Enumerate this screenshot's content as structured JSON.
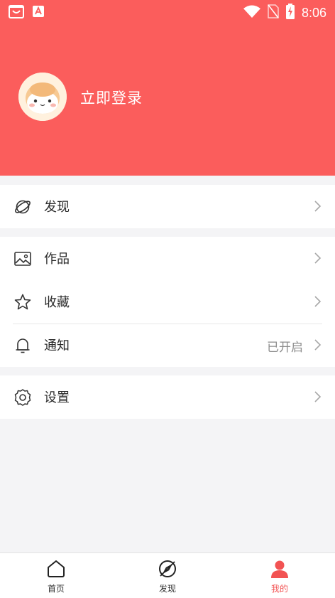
{
  "status_bar": {
    "time": "8:06",
    "icons": [
      "shopping-app-icon",
      "a-app-icon",
      "wifi-icon",
      "no-sim-icon",
      "battery-charging-icon"
    ]
  },
  "header": {
    "login_label": "立即登录",
    "background_color": "#fb5d5c"
  },
  "menu": {
    "discover": {
      "label": "发现",
      "icon": "planet-icon"
    },
    "works": {
      "label": "作品",
      "icon": "image-icon"
    },
    "favorites": {
      "label": "收藏",
      "icon": "star-icon"
    },
    "notifications": {
      "label": "通知",
      "icon": "bell-icon",
      "status": "已开启"
    },
    "settings": {
      "label": "设置",
      "icon": "gear-icon"
    }
  },
  "tab_bar": {
    "active_color": "#f25353",
    "items": [
      {
        "label": "首页",
        "icon": "home-icon"
      },
      {
        "label": "发现",
        "icon": "compass-icon"
      },
      {
        "label": "我的",
        "icon": "user-icon"
      }
    ]
  }
}
